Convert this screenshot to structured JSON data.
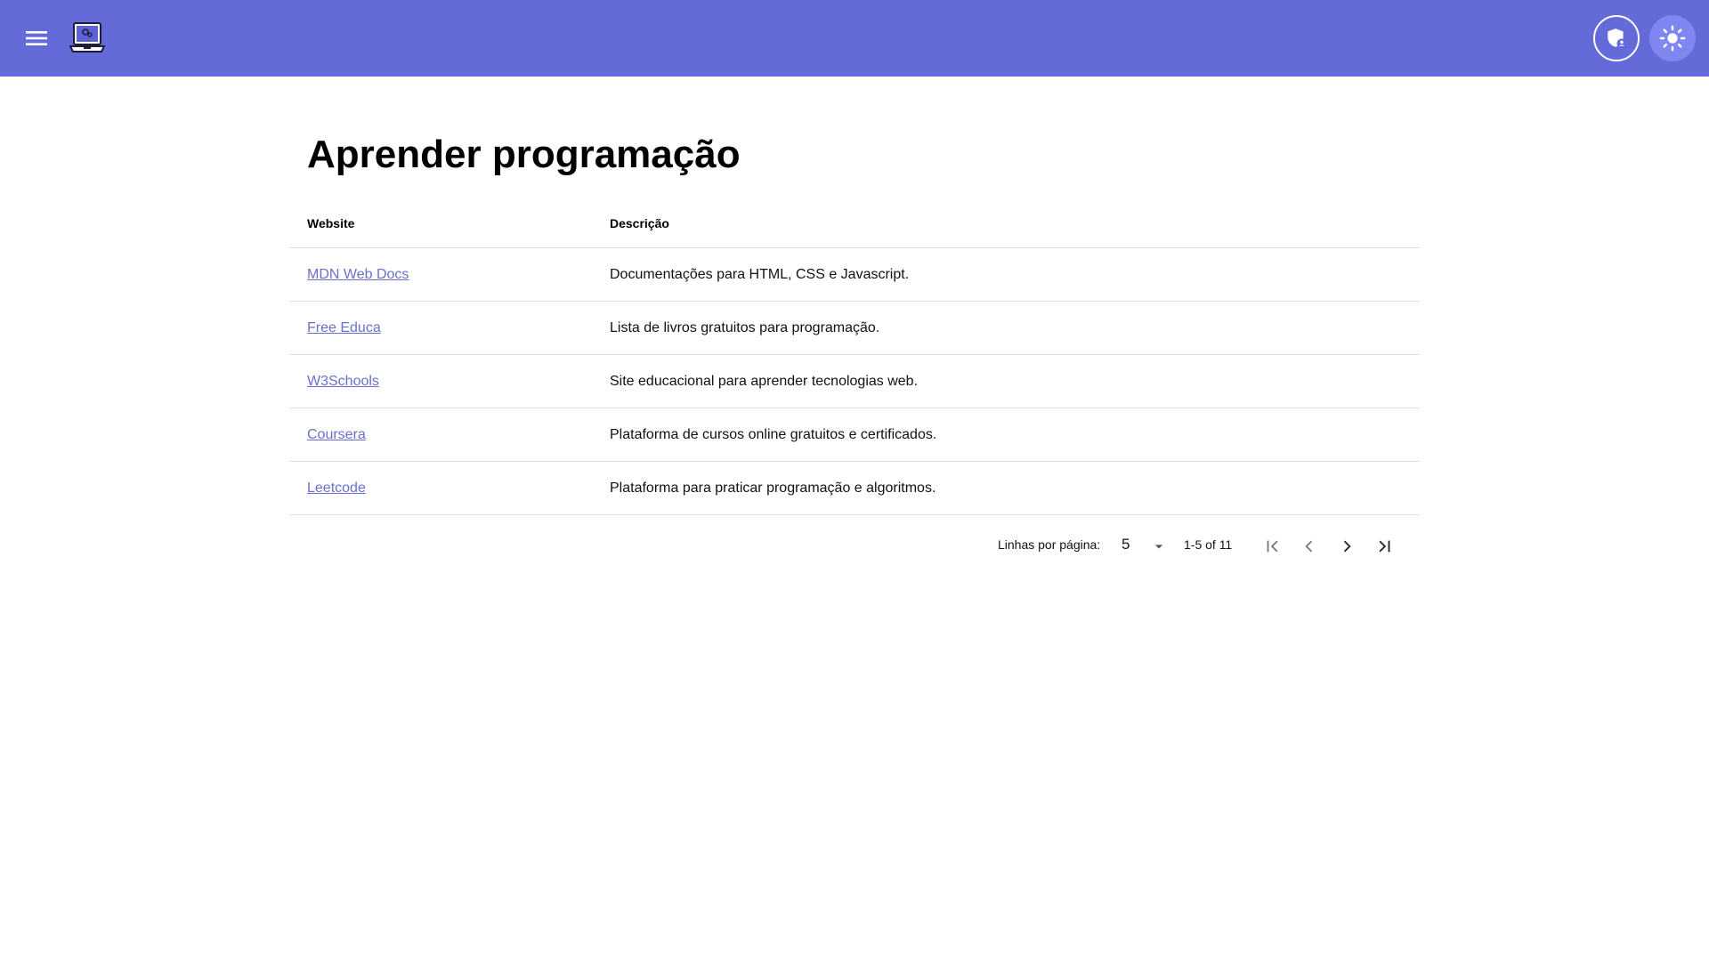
{
  "header": {
    "menu_icon": "hamburger-menu-icon",
    "logo_icon": "laptop-code-logo-icon",
    "admin_icon": "shield-user-icon",
    "theme_icon": "sun-icon",
    "bar_color": "#646bd9"
  },
  "page": {
    "title": "Aprender programação"
  },
  "table": {
    "columns": [
      "Website",
      "Descrição"
    ],
    "rows": [
      {
        "site": "MDN Web Docs",
        "description": "Documentações para HTML, CSS e Javascript."
      },
      {
        "site": "Free Educa",
        "description": "Lista de livros gratuitos para programação."
      },
      {
        "site": "W3Schools",
        "description": "Site educacional para aprender tecnologias web."
      },
      {
        "site": "Coursera",
        "description": "Plataforma de cursos online gratuitos e certificados."
      },
      {
        "site": "Leetcode",
        "description": "Plataforma para praticar programação e algoritmos."
      }
    ],
    "link_color": "#6a6fcf"
  },
  "pagination": {
    "rows_per_page_label": "Linhas por página:",
    "rows_per_page_value": "5",
    "range_text": "1-5 of 11",
    "first_icon": "first-page-icon",
    "prev_icon": "chevron-left-icon",
    "next_icon": "chevron-right-icon",
    "last_icon": "last-page-icon"
  }
}
